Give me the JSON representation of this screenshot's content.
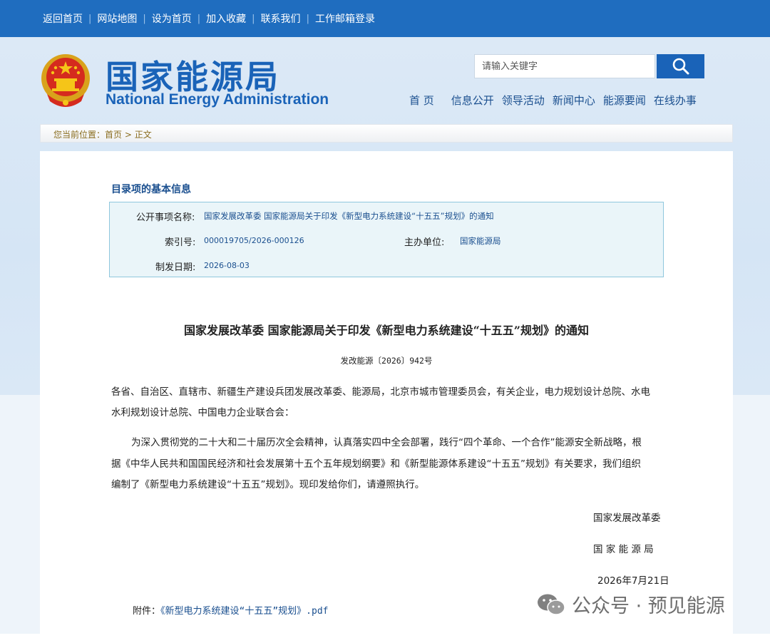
{
  "topbar": {
    "links": [
      "返回首页",
      "网站地图",
      "设为首页",
      "加入收藏",
      "联系我们",
      "工作邮箱登录"
    ]
  },
  "header": {
    "title_cn": "国家能源局",
    "title_en": "National Energy Administration",
    "search_placeholder": "请输入关键字",
    "nav": [
      "首 页",
      "信息公开",
      "领导活动",
      "新闻中心",
      "能源要闻",
      "在线办事"
    ]
  },
  "breadcrumb": {
    "prefix": "您当前位置：",
    "home": "首页",
    "separator": ">",
    "current": "正文"
  },
  "info": {
    "title": "目录项的基本信息",
    "name_label": "公开事项名称:",
    "name_value": "国家发展改革委 国家能源局关于印发《新型电力系统建设“十五五”规划》的通知",
    "index_label": "索引号:",
    "index_value": "000019705/2026-000126",
    "org_label": "主办单位:",
    "org_value": "国家能源局",
    "date_label": "制发日期:",
    "date_value": "2026-08-03"
  },
  "document": {
    "title": "国家发展改革委  国家能源局关于印发《新型电力系统建设“十五五”规划》的通知",
    "number": "发改能源〔2026〕942号",
    "recipients_line1": "各省、自治区、直辖市、新疆生产建设兵团发展改革委、能源局，北京市城市管理委员会，有关企业，电力规划设计总院、水电",
    "recipients_line2": "水利规划设计总院、中国电力企业联合会：",
    "body_line1": "为深入贯彻党的二十大和二十届历次全会精神，认真落实四中全会部署，践行“四个革命、一个合作”能源安全新战略，根",
    "body_line2": "据《中华人民共和国国民经济和社会发展第十五个五年规划纲要》和《新型能源体系建设“十五五”规划》有关要求，我们组织",
    "body_line3": "编制了《新型电力系统建设“十五五”规划》。现印发给你们，请遵照执行。",
    "signer1": "国家发展改革委",
    "signer2": "国 家 能 源 局",
    "date": "2026年7月21日",
    "attachment_label": "附件：",
    "attachment_link": "《新型电力系统建设“十五五”规划》.pdf"
  },
  "watermark": "公众号 · 预见能源",
  "colors": {
    "topbar": "#1f6dbf",
    "brand": "#1a63b8",
    "link": "#1a4f8f",
    "info_bg": "#eaf5f9"
  }
}
